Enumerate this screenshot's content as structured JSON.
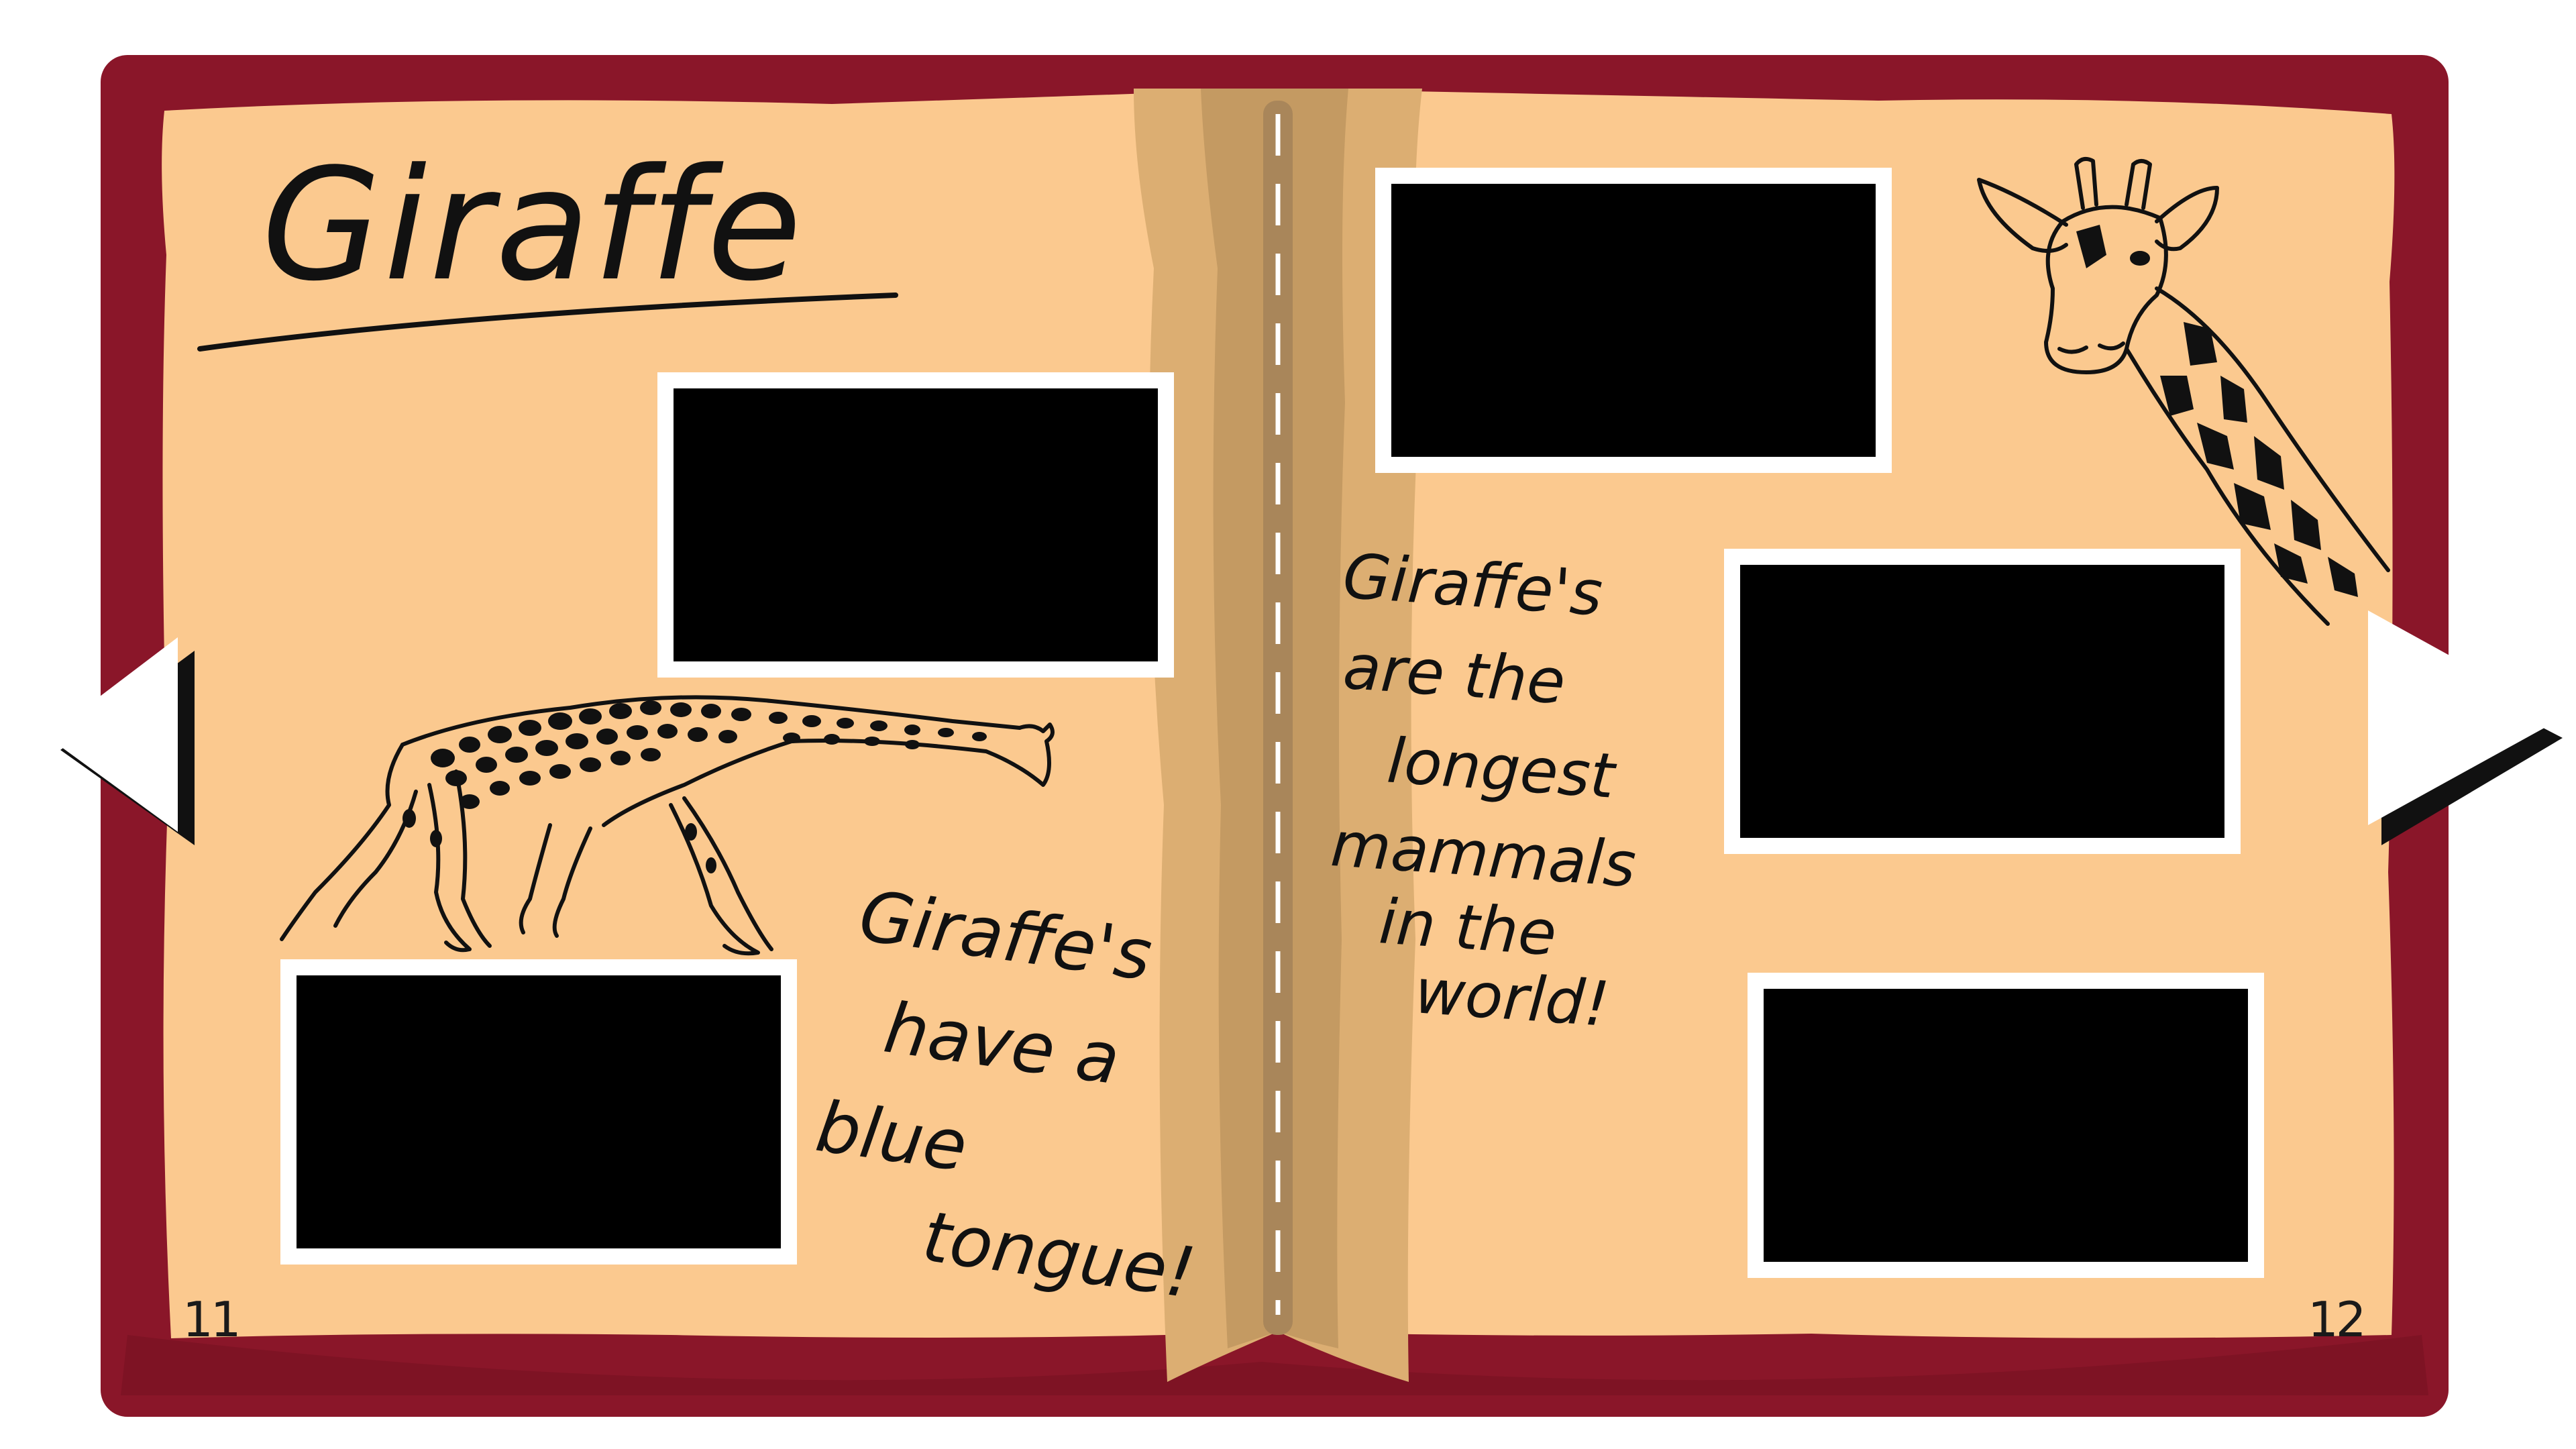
{
  "book": {
    "title": "Giraffe",
    "colors": {
      "cover": "#8a1629",
      "page": "#fbc98f",
      "gutter": "#dca86f",
      "photo_frame": "#ffffff",
      "photo": "#000000"
    }
  },
  "left_page": {
    "page_number": "11",
    "fact_lines": [
      "Giraffe's",
      "have a",
      "blue",
      "tongue!"
    ],
    "illustration": "giraffe-walking-drawing"
  },
  "right_page": {
    "page_number": "12",
    "fact_lines": [
      "Giraffe's",
      "are the",
      "longest",
      "mammals",
      "in the",
      "world!"
    ],
    "illustration": "giraffe-head-drawing"
  },
  "navigation": {
    "previous_icon": "triangle-left-icon",
    "next_icon": "triangle-right-icon"
  }
}
